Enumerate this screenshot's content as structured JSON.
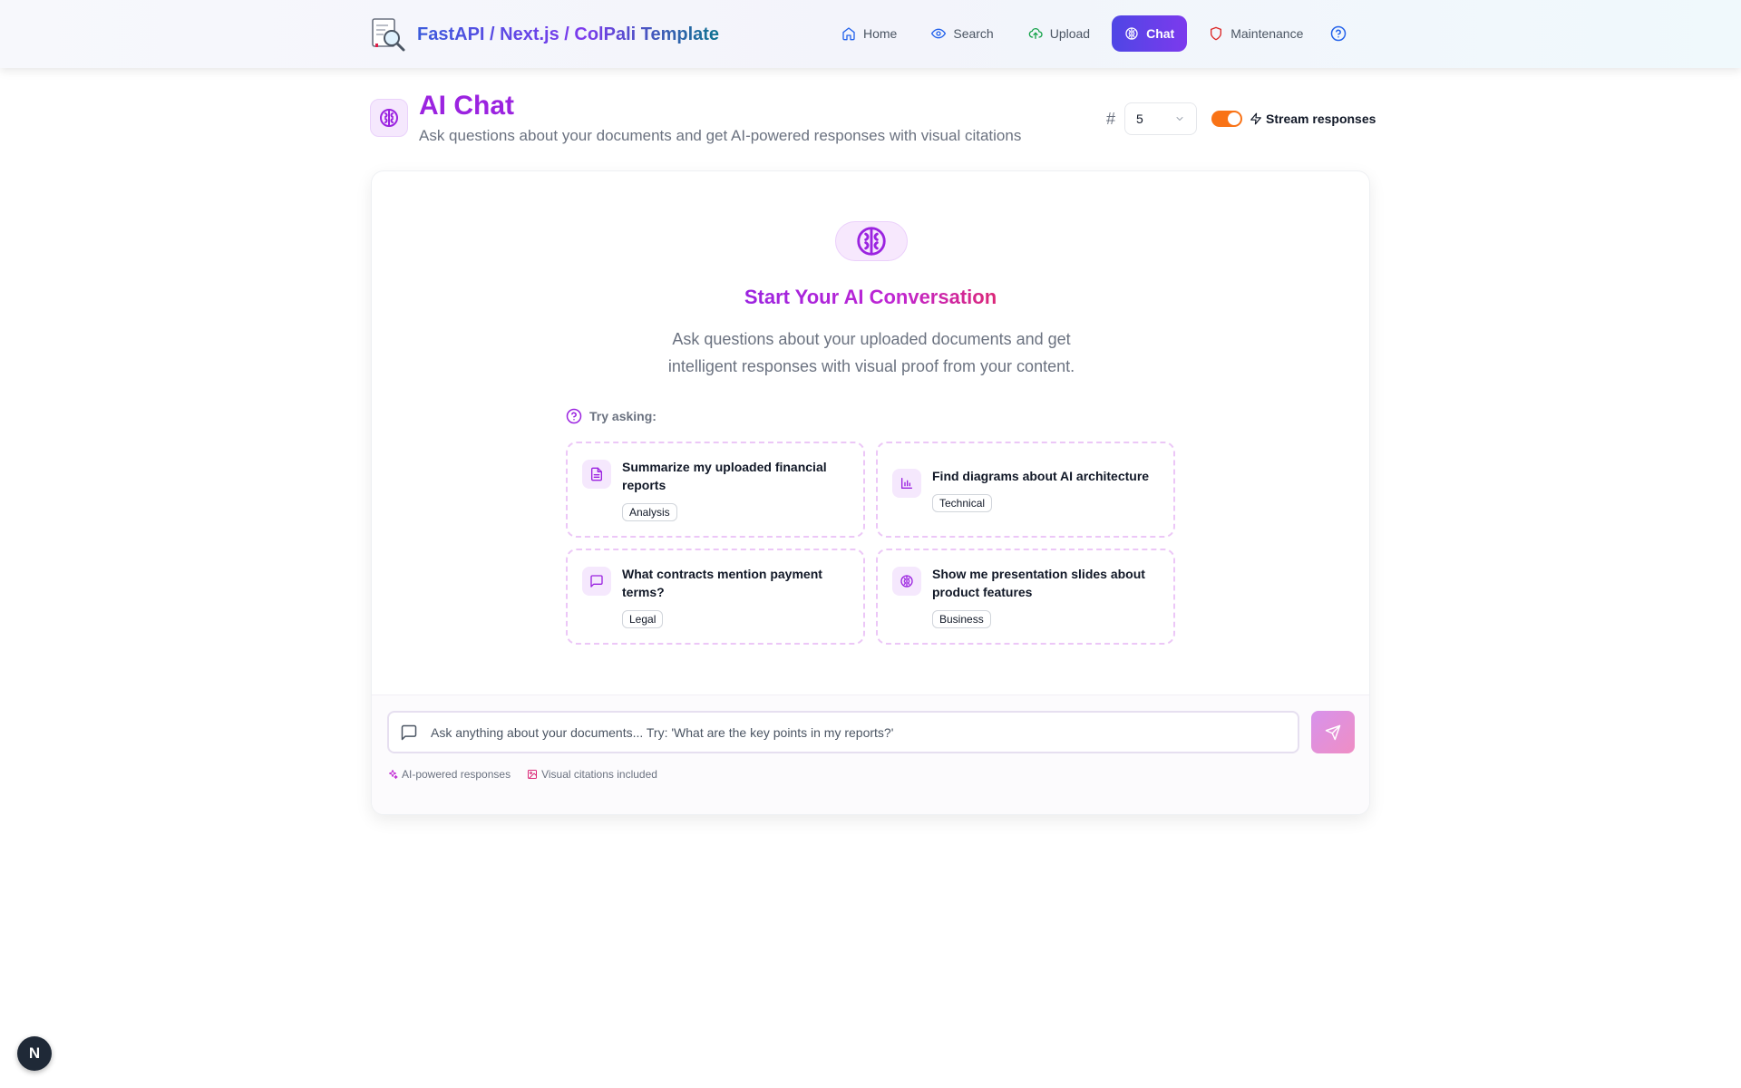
{
  "header": {
    "brand": "FastAPI / Next.js / ColPali Template",
    "nav": [
      {
        "label": "Home",
        "icon": "home-icon",
        "color": "#2563eb"
      },
      {
        "label": "Search",
        "icon": "eye-icon",
        "color": "#2563eb"
      },
      {
        "label": "Upload",
        "icon": "cloud-upload-icon",
        "color": "#16a34a"
      },
      {
        "label": "Chat",
        "icon": "brain-icon",
        "active": true
      },
      {
        "label": "Maintenance",
        "icon": "shield-icon",
        "color": "#dc2626"
      }
    ]
  },
  "page": {
    "title": "AI Chat",
    "subtitle": "Ask questions about your documents and get AI-powered responses with visual citations",
    "k_symbol": "#",
    "k_value": "5",
    "stream_label": "Stream responses",
    "stream_enabled": true
  },
  "empty_state": {
    "title": "Start Your AI Conversation",
    "description": "Ask questions about your uploaded documents and get intelligent responses with visual proof from your content.",
    "try_label": "Try asking:",
    "suggestions": [
      {
        "text": "Summarize my uploaded financial reports",
        "tag": "Analysis",
        "icon": "file-text-icon"
      },
      {
        "text": "Find diagrams about AI architecture",
        "tag": "Technical",
        "icon": "bar-chart-icon"
      },
      {
        "text": "What contracts mention payment terms?",
        "tag": "Legal",
        "icon": "message-square-icon"
      },
      {
        "text": "Show me presentation slides about product features",
        "tag": "Business",
        "icon": "brain-icon"
      }
    ]
  },
  "composer": {
    "placeholder": "Ask anything about your documents... Try: 'What are the key points in my reports?'",
    "features": [
      "AI-powered responses",
      "Visual citations included"
    ]
  },
  "dev_badge": "N",
  "colors": {
    "accent": "#9b23e0",
    "active_nav": "#5b3fe6",
    "toggle": "#f97316"
  }
}
